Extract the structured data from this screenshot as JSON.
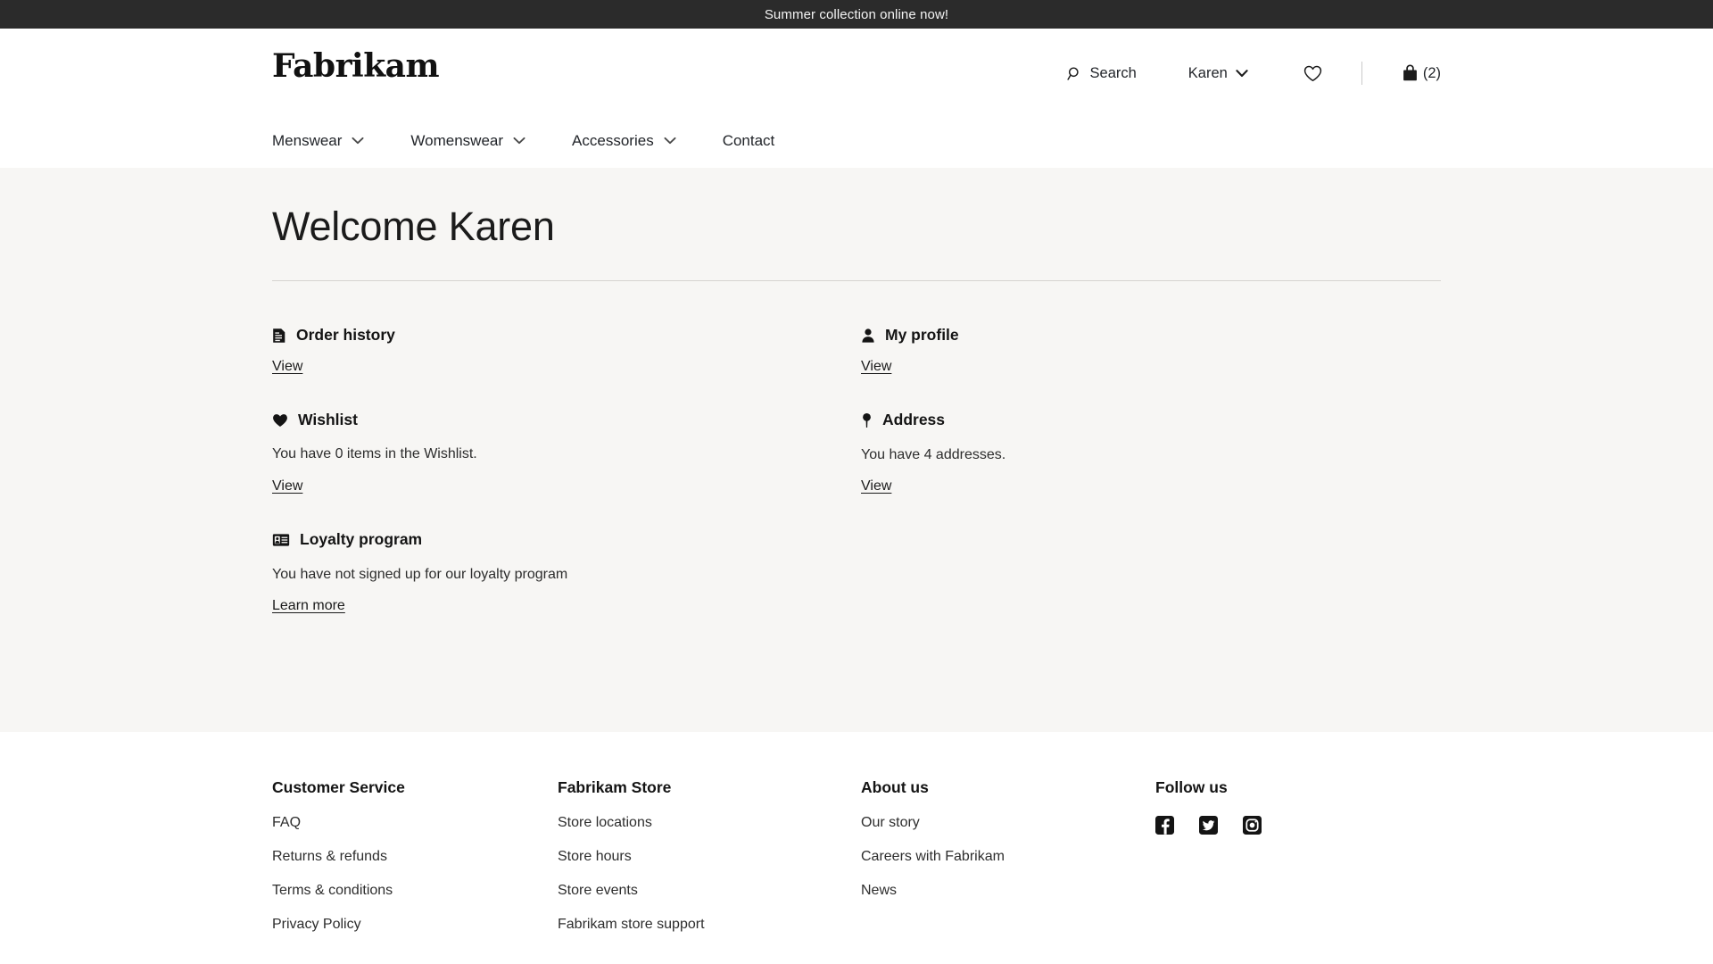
{
  "promo_banner": {
    "message": "Summer collection online now!"
  },
  "header": {
    "brand": "Fabrikam",
    "utility": {
      "search_label": "Search",
      "search_icon": "search-icon",
      "account_label": "Karen",
      "account_chevron_icon": "chevron-down-icon",
      "wishlist_icon": "heart-outline-icon",
      "bag_icon": "shopping-bag-icon",
      "bag_count": "(2)"
    },
    "nav": [
      {
        "label": "Menswear",
        "has_dropdown": true
      },
      {
        "label": "Womenswear",
        "has_dropdown": true
      },
      {
        "label": "Accessories",
        "has_dropdown": true
      },
      {
        "label": "Contact",
        "has_dropdown": false
      }
    ]
  },
  "main": {
    "title": "Welcome Karen",
    "cards": [
      {
        "id": "order-history",
        "icon": "document-icon",
        "title": "Order history",
        "description": "",
        "link_label": "View"
      },
      {
        "id": "my-profile",
        "icon": "person-icon",
        "title": "My profile",
        "description": "",
        "link_label": "View"
      },
      {
        "id": "wishlist",
        "icon": "heart-filled-icon",
        "title": "Wishlist",
        "description": "You have 0 items in the Wishlist.",
        "link_label": "View"
      },
      {
        "id": "address",
        "icon": "map-pin-icon",
        "title": "Address",
        "description": "You have 4 addresses.",
        "link_label": "View"
      },
      {
        "id": "loyalty-program",
        "icon": "id-card-icon",
        "title": "Loyalty program",
        "description": "You have not signed up for our loyalty program",
        "link_label": "Learn more"
      }
    ]
  },
  "footer": {
    "columns": [
      {
        "heading": "Customer Service",
        "links": [
          "FAQ",
          "Returns & refunds",
          "Terms & conditions",
          "Privacy Policy"
        ]
      },
      {
        "heading": "Fabrikam Store",
        "links": [
          "Store locations",
          "Store hours",
          "Store events",
          "Fabrikam store support"
        ]
      },
      {
        "heading": "About us",
        "links": [
          "Our story",
          "Careers with Fabrikam",
          "News"
        ]
      }
    ],
    "social": {
      "heading": "Follow us",
      "items": [
        "facebook-icon",
        "twitter-icon",
        "instagram-icon"
      ]
    }
  },
  "colors": {
    "banner_bg": "#2b2b2b",
    "content_bg": "#f7f6f4",
    "text": "#1b1b1b",
    "rule": "#d6d4d0"
  }
}
